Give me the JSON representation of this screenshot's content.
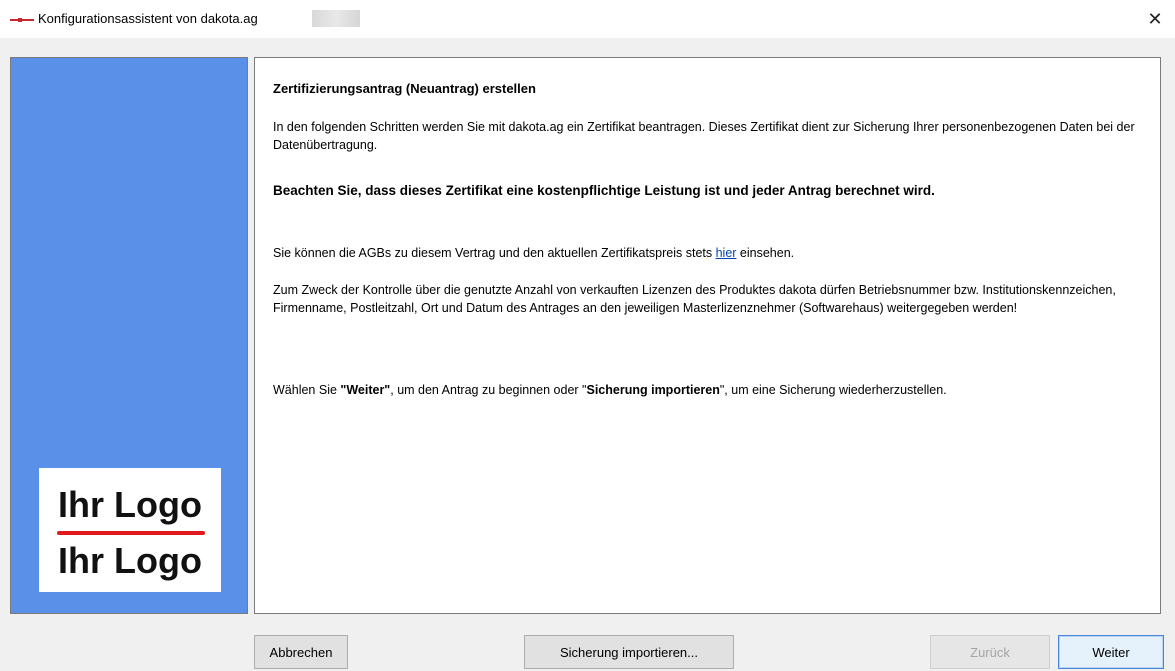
{
  "window": {
    "title": "Konfigurationsassistent von dakota.ag",
    "close_glyph": "✕"
  },
  "sidebar": {
    "logo_top": "Ihr Logo",
    "logo_bottom": "Ihr Logo"
  },
  "content": {
    "heading": "Zertifizierungsantrag (Neuantrag) erstellen",
    "intro": "In den folgenden Schritten werden Sie mit dakota.ag ein Zertifikat beantragen. Dieses Zertifikat dient zur Sicherung Ihrer personenbezogenen Daten bei der Datenübertragung.",
    "warning": "Beachten Sie, dass dieses Zertifikat eine kostenpflichtige Leistung ist und jeder Antrag berechnet wird.",
    "agb_before": "Sie können die AGBs zu diesem Vertrag und den aktuellen Zertifikatspreis stets ",
    "agb_link": "hier",
    "agb_after": " einsehen.",
    "control": "Zum Zweck der Kontrolle über die genutzte Anzahl von verkauften Lizenzen des Produktes dakota dürfen Betriebsnummer bzw. Institutionskennzeichen, Firmenname, Postleitzahl, Ort und Datum des Antrages an den jeweiligen Masterlizenznehmer (Softwarehaus) weitergegeben werden!",
    "choose_1": "Wählen Sie ",
    "choose_bold_1": "\"Weiter\"",
    "choose_2": ", um den Antrag zu beginnen oder \"",
    "choose_bold_2": "Sicherung importieren",
    "choose_3": "\", um eine Sicherung wiederherzustellen."
  },
  "buttons": {
    "cancel": "Abbrechen",
    "import": "Sicherung importieren...",
    "back": "Zurück",
    "next": "Weiter"
  },
  "colors": {
    "sidebar_bg": "#5b90e8",
    "logo_accent": "#e0191f",
    "link": "#0645ad"
  }
}
